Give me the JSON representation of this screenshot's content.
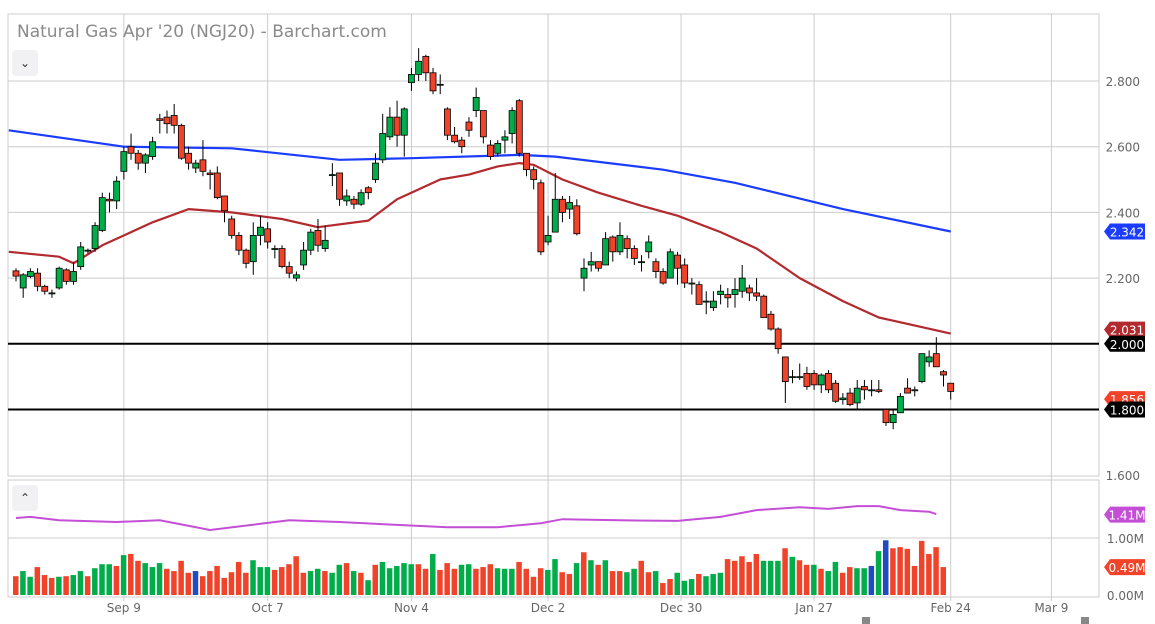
{
  "header": {
    "title": "Natural Gas Apr '20 (NGJ20) - Barchart.com",
    "collapse_icon": "chevron-down-icon",
    "volume_collapse_icon": "chevron-up-icon"
  },
  "colors": {
    "up": "#00ad4a",
    "down": "#f1432a",
    "ma_long": "#1a3cff",
    "ma_short": "#b32a2e",
    "volume_avg": "#c44fd6",
    "volume_other": "#1f4cc0",
    "support_line": "#000000",
    "grid": "#cccccc"
  },
  "chart_data": [
    {
      "type": "candlestick",
      "title": "Natural Gas Apr '20 (NGJ20) - Barchart.com",
      "ylim": [
        1.6,
        2.9
      ],
      "y_ticks": [
        "2.800",
        "2.600",
        "2.400",
        "2.200",
        "1.600"
      ],
      "y_tick_values": [
        2.8,
        2.6,
        2.4,
        2.2,
        1.6
      ],
      "x_tick_labels": [
        "Sep 9",
        "Oct 7",
        "Nov 4",
        "Dec 2",
        "Dec 30",
        "Jan 27",
        "Feb 24",
        "Mar 9"
      ],
      "x_tick_bar_index": [
        15,
        35,
        55,
        74,
        92.5,
        111,
        130,
        144
      ],
      "grid": true,
      "ohlc": [
        [
          2.222,
          2.23,
          2.19,
          2.206
        ],
        [
          2.17,
          2.215,
          2.14,
          2.21
        ],
        [
          2.205,
          2.23,
          2.2,
          2.22
        ],
        [
          2.215,
          2.23,
          2.16,
          2.175
        ],
        [
          2.175,
          2.18,
          2.15,
          2.16
        ],
        [
          2.155,
          2.165,
          2.14,
          2.155
        ],
        [
          2.17,
          2.235,
          2.165,
          2.23
        ],
        [
          2.225,
          2.23,
          2.18,
          2.19
        ],
        [
          2.19,
          2.25,
          2.18,
          2.22
        ],
        [
          2.235,
          2.31,
          2.225,
          2.295
        ],
        [
          2.285,
          2.29,
          2.275,
          2.285
        ],
        [
          2.29,
          2.37,
          2.28,
          2.36
        ],
        [
          2.345,
          2.46,
          2.34,
          2.445
        ],
        [
          2.44,
          2.46,
          2.4,
          2.435
        ],
        [
          2.435,
          2.51,
          2.41,
          2.495
        ],
        [
          2.525,
          2.6,
          2.5,
          2.585
        ],
        [
          2.6,
          2.64,
          2.56,
          2.58
        ],
        [
          2.58,
          2.59,
          2.53,
          2.55
        ],
        [
          2.55,
          2.58,
          2.52,
          2.575
        ],
        [
          2.57,
          2.63,
          2.56,
          2.615
        ],
        [
          2.685,
          2.7,
          2.64,
          2.68
        ],
        [
          2.69,
          2.71,
          2.64,
          2.67
        ],
        [
          2.695,
          2.73,
          2.64,
          2.665
        ],
        [
          2.665,
          2.67,
          2.56,
          2.565
        ],
        [
          2.58,
          2.6,
          2.53,
          2.55
        ],
        [
          2.535,
          2.56,
          2.52,
          2.55
        ],
        [
          2.56,
          2.62,
          2.51,
          2.525
        ],
        [
          2.52,
          2.53,
          2.47,
          2.515
        ],
        [
          2.52,
          2.54,
          2.44,
          2.445
        ],
        [
          2.45,
          2.45,
          2.37,
          2.405
        ],
        [
          2.38,
          2.39,
          2.32,
          2.33
        ],
        [
          2.33,
          2.34,
          2.27,
          2.285
        ],
        [
          2.285,
          2.29,
          2.23,
          2.245
        ],
        [
          2.25,
          2.37,
          2.21,
          2.33
        ],
        [
          2.33,
          2.39,
          2.3,
          2.355
        ],
        [
          2.35,
          2.37,
          2.29,
          2.31
        ],
        [
          2.29,
          2.3,
          2.26,
          2.29
        ],
        [
          2.29,
          2.3,
          2.23,
          2.235
        ],
        [
          2.235,
          2.25,
          2.2,
          2.215
        ],
        [
          2.2,
          2.22,
          2.19,
          2.21
        ],
        [
          2.24,
          2.31,
          2.225,
          2.285
        ],
        [
          2.285,
          2.35,
          2.27,
          2.34
        ],
        [
          2.345,
          2.38,
          2.28,
          2.3
        ],
        [
          2.29,
          2.36,
          2.28,
          2.315
        ],
        [
          2.515,
          2.55,
          2.48,
          2.515
        ],
        [
          2.52,
          2.52,
          2.42,
          2.44
        ],
        [
          2.435,
          2.47,
          2.42,
          2.45
        ],
        [
          2.44,
          2.45,
          2.41,
          2.425
        ],
        [
          2.425,
          2.47,
          2.42,
          2.46
        ],
        [
          2.475,
          2.48,
          2.44,
          2.46
        ],
        [
          2.5,
          2.58,
          2.49,
          2.55
        ],
        [
          2.56,
          2.7,
          2.55,
          2.64
        ],
        [
          2.63,
          2.72,
          2.62,
          2.69
        ],
        [
          2.69,
          2.74,
          2.6,
          2.635
        ],
        [
          2.635,
          2.72,
          2.57,
          2.715
        ],
        [
          2.795,
          2.84,
          2.77,
          2.82
        ],
        [
          2.82,
          2.9,
          2.8,
          2.86
        ],
        [
          2.875,
          2.88,
          2.8,
          2.825
        ],
        [
          2.825,
          2.84,
          2.76,
          2.77
        ],
        [
          2.79,
          2.82,
          2.76,
          2.79
        ],
        [
          2.715,
          2.72,
          2.62,
          2.635
        ],
        [
          2.635,
          2.66,
          2.61,
          2.615
        ],
        [
          2.62,
          2.63,
          2.58,
          2.6
        ],
        [
          2.675,
          2.69,
          2.63,
          2.65
        ],
        [
          2.71,
          2.78,
          2.69,
          2.75
        ],
        [
          2.71,
          2.71,
          2.61,
          2.63
        ],
        [
          2.605,
          2.62,
          2.56,
          2.57
        ],
        [
          2.58,
          2.62,
          2.57,
          2.61
        ],
        [
          2.62,
          2.65,
          2.58,
          2.63
        ],
        [
          2.64,
          2.72,
          2.61,
          2.71
        ],
        [
          2.74,
          2.745,
          2.57,
          2.58
        ],
        [
          2.58,
          2.58,
          2.51,
          2.53
        ],
        [
          2.53,
          2.54,
          2.47,
          2.5
        ],
        [
          2.49,
          2.5,
          2.27,
          2.28
        ],
        [
          2.31,
          2.39,
          2.3,
          2.33
        ],
        [
          2.34,
          2.52,
          2.34,
          2.44
        ],
        [
          2.44,
          2.45,
          2.37,
          2.4
        ],
        [
          2.41,
          2.45,
          2.38,
          2.43
        ],
        [
          2.42,
          2.44,
          2.33,
          2.335
        ],
        [
          2.2,
          2.26,
          2.16,
          2.23
        ],
        [
          2.24,
          2.28,
          2.22,
          2.25
        ],
        [
          2.25,
          2.25,
          2.22,
          2.23
        ],
        [
          2.24,
          2.34,
          2.24,
          2.32
        ],
        [
          2.325,
          2.33,
          2.25,
          2.28
        ],
        [
          2.28,
          2.37,
          2.27,
          2.33
        ],
        [
          2.32,
          2.33,
          2.26,
          2.29
        ],
        [
          2.29,
          2.3,
          2.24,
          2.26
        ],
        [
          2.25,
          2.27,
          2.22,
          2.25
        ],
        [
          2.28,
          2.33,
          2.26,
          2.31
        ],
        [
          2.25,
          2.26,
          2.2,
          2.22
        ],
        [
          2.22,
          2.23,
          2.18,
          2.185
        ],
        [
          2.2,
          2.29,
          2.2,
          2.28
        ],
        [
          2.27,
          2.28,
          2.18,
          2.23
        ],
        [
          2.24,
          2.26,
          2.17,
          2.185
        ],
        [
          2.185,
          2.2,
          2.15,
          2.185
        ],
        [
          2.18,
          2.19,
          2.12,
          2.12
        ],
        [
          2.13,
          2.16,
          2.09,
          2.13
        ],
        [
          2.11,
          2.16,
          2.1,
          2.13
        ],
        [
          2.15,
          2.18,
          2.12,
          2.16
        ],
        [
          2.15,
          2.17,
          2.11,
          2.14
        ],
        [
          2.15,
          2.2,
          2.11,
          2.165
        ],
        [
          2.16,
          2.24,
          2.14,
          2.2
        ],
        [
          2.17,
          2.18,
          2.13,
          2.155
        ],
        [
          2.155,
          2.2,
          2.13,
          2.145
        ],
        [
          2.145,
          2.15,
          2.08,
          2.08
        ],
        [
          2.09,
          2.1,
          2.04,
          2.045
        ],
        [
          2.045,
          2.05,
          1.97,
          1.985
        ],
        [
          1.96,
          1.96,
          1.82,
          1.885
        ],
        [
          1.9,
          1.92,
          1.88,
          1.9
        ],
        [
          1.9,
          1.94,
          1.89,
          1.9
        ],
        [
          1.91,
          1.93,
          1.86,
          1.87
        ],
        [
          1.91,
          1.92,
          1.86,
          1.875
        ],
        [
          1.875,
          1.91,
          1.85,
          1.905
        ],
        [
          1.91,
          1.92,
          1.85,
          1.86
        ],
        [
          1.88,
          1.89,
          1.82,
          1.825
        ],
        [
          1.83,
          1.85,
          1.815,
          1.835
        ],
        [
          1.85,
          1.865,
          1.81,
          1.815
        ],
        [
          1.82,
          1.89,
          1.8,
          1.865
        ],
        [
          1.87,
          1.89,
          1.83,
          1.86
        ],
        [
          1.86,
          1.89,
          1.84,
          1.86
        ],
        [
          1.86,
          1.89,
          1.85,
          1.855
        ],
        [
          1.8,
          1.8,
          1.75,
          1.76
        ],
        [
          1.76,
          1.8,
          1.74,
          1.785
        ],
        [
          1.79,
          1.85,
          1.79,
          1.84
        ],
        [
          1.865,
          1.895,
          1.85,
          1.85
        ],
        [
          1.86,
          1.87,
          1.84,
          1.86
        ],
        [
          1.885,
          1.97,
          1.88,
          1.97
        ],
        [
          1.945,
          1.98,
          1.93,
          1.96
        ],
        [
          1.97,
          2.02,
          1.93,
          1.93
        ],
        [
          1.915,
          1.92,
          1.87,
          1.905
        ],
        [
          1.88,
          1.88,
          1.83,
          1.855
        ]
      ],
      "moving_averages": [
        {
          "name": "long MA",
          "label": "2.342",
          "knots": [
            [
              -1,
              2.65
            ],
            [
              15,
              2.6
            ],
            [
              30,
              2.595
            ],
            [
              45,
              2.56
            ],
            [
              55,
              2.565
            ],
            [
              70,
              2.575
            ],
            [
              75,
              2.57
            ],
            [
              90,
              2.53
            ],
            [
              100,
              2.49
            ],
            [
              115,
              2.41
            ],
            [
              130,
              2.342
            ]
          ]
        },
        {
          "name": "short MA",
          "label": "2.031",
          "knots": [
            [
              -1,
              2.28
            ],
            [
              6,
              2.265
            ],
            [
              8,
              2.245
            ],
            [
              12,
              2.3
            ],
            [
              19,
              2.37
            ],
            [
              24,
              2.41
            ],
            [
              30,
              2.4
            ],
            [
              37,
              2.38
            ],
            [
              42,
              2.355
            ],
            [
              49,
              2.375
            ],
            [
              53,
              2.44
            ],
            [
              59,
              2.5
            ],
            [
              63,
              2.515
            ],
            [
              67,
              2.54
            ],
            [
              70,
              2.55
            ],
            [
              72,
              2.545
            ],
            [
              76,
              2.5
            ],
            [
              81,
              2.46
            ],
            [
              87,
              2.42
            ],
            [
              92,
              2.39
            ],
            [
              98,
              2.34
            ],
            [
              103,
              2.29
            ],
            [
              109,
              2.2
            ],
            [
              115,
              2.13
            ],
            [
              120,
              2.08
            ],
            [
              130,
              2.031
            ]
          ]
        }
      ],
      "horizontal_lines": [
        {
          "value": 2.0,
          "label": "2.000"
        },
        {
          "value": 1.8,
          "label": "1.800"
        }
      ],
      "last_price_label": "1.856"
    },
    {
      "type": "bar",
      "title": "Volume",
      "ylim": [
        0,
        2.0
      ],
      "y_ticks": [
        "1.00M",
        "0.00M"
      ],
      "y_tick_values": [
        1.0,
        0.0
      ],
      "values_millions": [
        0.33,
        0.42,
        0.32,
        0.49,
        0.35,
        0.3,
        0.32,
        0.33,
        0.35,
        0.42,
        0.33,
        0.47,
        0.54,
        0.54,
        0.51,
        0.7,
        0.72,
        0.6,
        0.56,
        0.49,
        0.56,
        0.46,
        0.42,
        0.6,
        0.39,
        0.42,
        0.33,
        0.42,
        0.51,
        0.3,
        0.4,
        0.58,
        0.39,
        0.61,
        0.49,
        0.49,
        0.44,
        0.49,
        0.54,
        0.68,
        0.39,
        0.42,
        0.46,
        0.42,
        0.39,
        0.53,
        0.56,
        0.42,
        0.39,
        0.26,
        0.53,
        0.58,
        0.47,
        0.51,
        0.56,
        0.54,
        0.54,
        0.46,
        0.72,
        0.44,
        0.56,
        0.46,
        0.53,
        0.54,
        0.46,
        0.49,
        0.54,
        0.47,
        0.46,
        0.46,
        0.58,
        0.46,
        0.32,
        0.47,
        0.44,
        0.63,
        0.4,
        0.37,
        0.56,
        0.75,
        0.61,
        0.53,
        0.61,
        0.42,
        0.42,
        0.4,
        0.46,
        0.6,
        0.4,
        0.42,
        0.21,
        0.28,
        0.39,
        0.25,
        0.28,
        0.37,
        0.33,
        0.37,
        0.39,
        0.63,
        0.6,
        0.68,
        0.58,
        0.72,
        0.6,
        0.6,
        0.6,
        0.82,
        0.67,
        0.61,
        0.53,
        0.53,
        0.46,
        0.42,
        0.58,
        0.39,
        0.49,
        0.47,
        0.47,
        0.51,
        0.77,
        0.96,
        0.82,
        0.84,
        0.81,
        0.51,
        0.95,
        0.72,
        0.84,
        0.49
      ],
      "bar_colors": "rggrrrgrggrgggrgrrgggrrrrbrrrrrrrgggrrrrrggrggrgrgrgggggrrgrrrggrrrgggrrrrggrrgrgrgrrggrrgrrgggrgggrrrrrgggrgrrgrggrrggbgbrr",
      "average": {
        "label": "1.41M",
        "knots": [
          [
            0,
            1.35
          ],
          [
            2,
            1.37
          ],
          [
            6,
            1.31
          ],
          [
            14,
            1.28
          ],
          [
            20,
            1.31
          ],
          [
            27,
            1.14
          ],
          [
            34,
            1.25
          ],
          [
            38,
            1.31
          ],
          [
            45,
            1.28
          ],
          [
            53,
            1.23
          ],
          [
            60,
            1.19
          ],
          [
            67,
            1.19
          ],
          [
            73,
            1.26
          ],
          [
            76,
            1.33
          ],
          [
            84,
            1.31
          ],
          [
            92,
            1.3
          ],
          [
            98,
            1.37
          ],
          [
            103,
            1.49
          ],
          [
            109,
            1.54
          ],
          [
            113,
            1.51
          ],
          [
            117,
            1.56
          ],
          [
            120,
            1.56
          ],
          [
            123,
            1.49
          ],
          [
            127,
            1.46
          ],
          [
            128,
            1.42
          ]
        ]
      },
      "last_volume_label": "0.49M"
    }
  ]
}
